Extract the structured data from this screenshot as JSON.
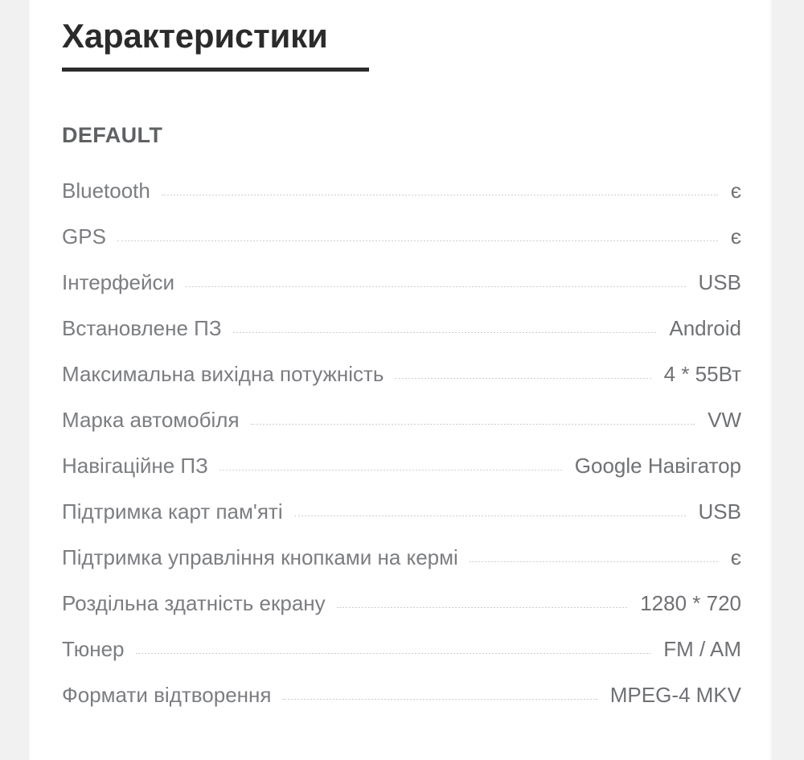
{
  "page": {
    "title": "Характеристики",
    "background_color": "#f1f1f1",
    "card_color": "#ffffff",
    "title_color": "#2b2b2b",
    "label_color": "#7b7d81",
    "value_color": "#6f7175",
    "section_color": "#5f6163",
    "leader_color": "#cdcdcd"
  },
  "section": {
    "label": "DEFAULT"
  },
  "specs": [
    {
      "label": "Bluetooth",
      "value": "є"
    },
    {
      "label": "GPS",
      "value": "є"
    },
    {
      "label": "Інтерфейси",
      "value": "USB"
    },
    {
      "label": "Встановлене ПЗ",
      "value": "Android"
    },
    {
      "label": "Максимальна вихідна потужність",
      "value": "4 * 55Вт"
    },
    {
      "label": "Марка автомобіля",
      "value": "VW"
    },
    {
      "label": "Навігаційне ПЗ",
      "value": "Google Навігатор"
    },
    {
      "label": "Підтримка карт пам'яті",
      "value": "USB"
    },
    {
      "label": "Підтримка управління кнопками на кермі",
      "value": "є"
    },
    {
      "label": "Роздільна здатність екрану",
      "value": "1280 * 720"
    },
    {
      "label": "Тюнер",
      "value": "FM / AM"
    },
    {
      "label": "Формати відтворення",
      "value": "MPEG-4 MKV"
    }
  ]
}
